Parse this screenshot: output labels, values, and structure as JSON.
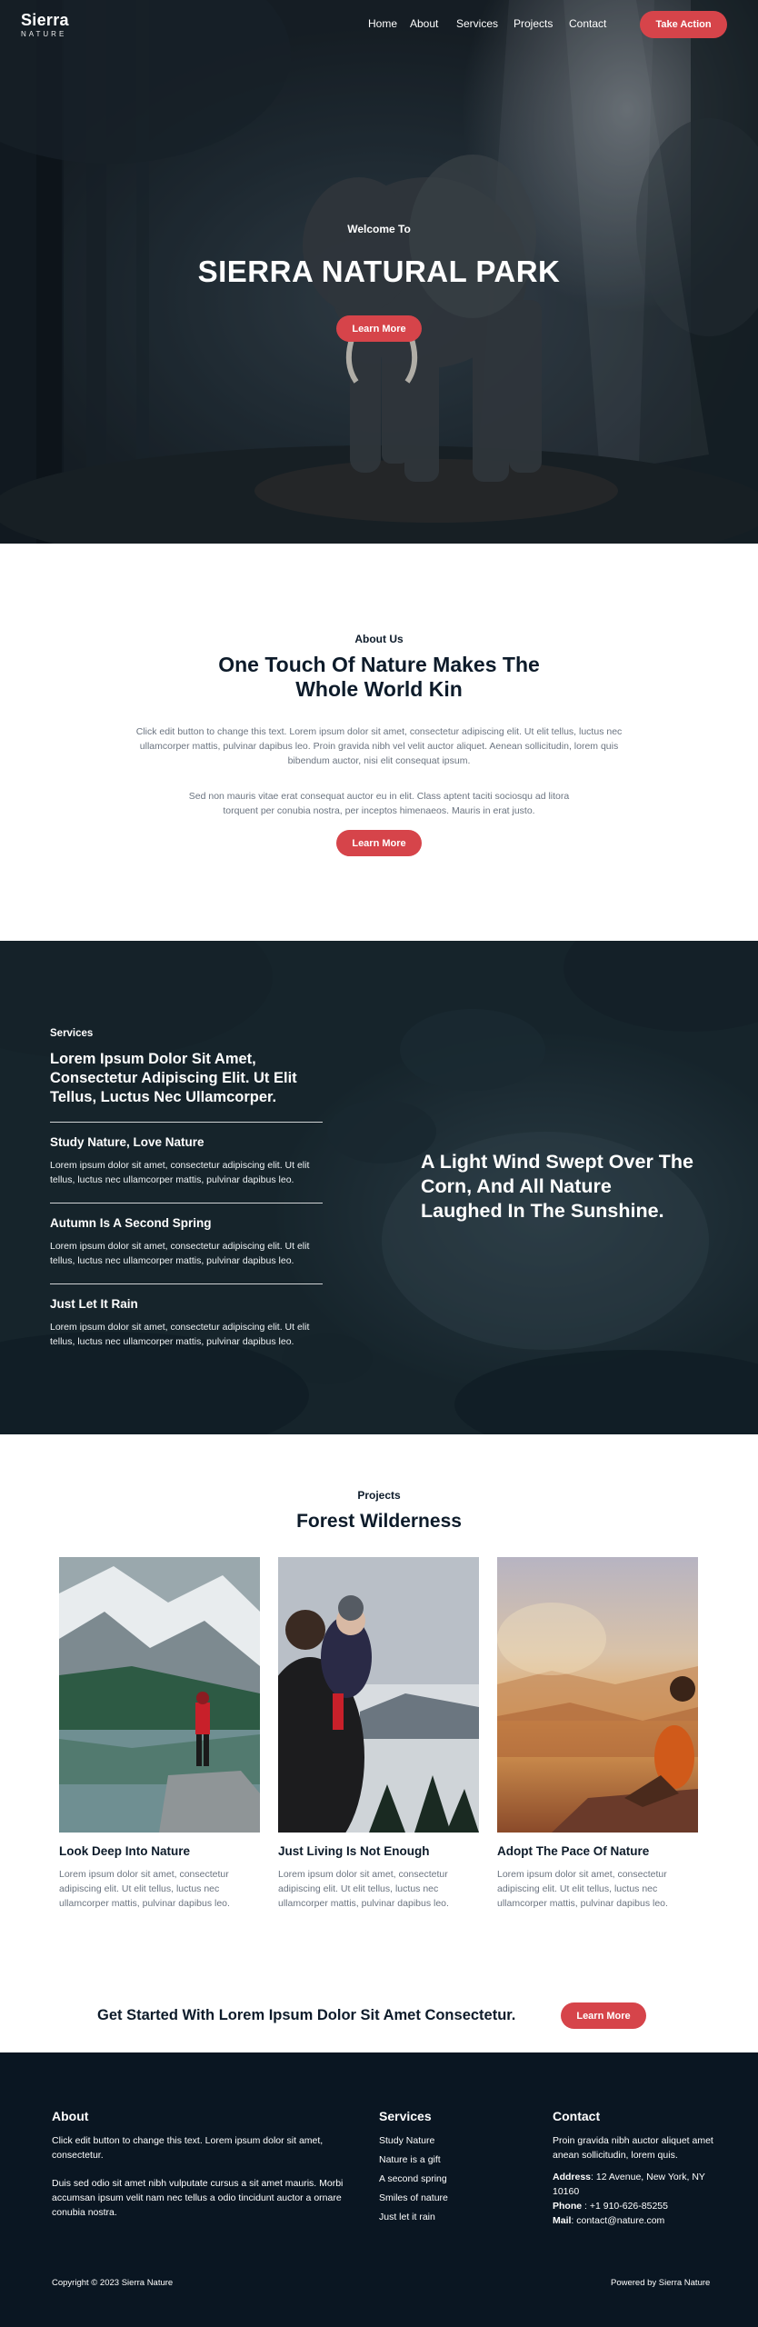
{
  "colors": {
    "accent": "#d6444a",
    "dark": "#0a1622",
    "text": "#0d1b2a",
    "muted": "#6b7480"
  },
  "header": {
    "logo_main": "Sierra",
    "logo_sub": "NATURE",
    "nav": [
      "Home",
      "About",
      "Services",
      "Projects",
      "Contact"
    ],
    "cta_label": "Take Action"
  },
  "hero": {
    "welcome": "Welcome To",
    "title": "SIERRA NATURAL PARK",
    "button": "Learn More"
  },
  "about": {
    "label": "About Us",
    "title": "One Touch Of Nature Makes The Whole World Kin",
    "paragraph1": "Click edit button to change this text. Lorem ipsum dolor sit amet, consectetur adipiscing elit. Ut elit tellus, luctus nec ullamcorper mattis, pulvinar dapibus leo. Proin gravida nibh vel velit auctor aliquet. Aenean sollicitudin, lorem quis bibendum auctor, nisi elit consequat ipsum.",
    "paragraph2": "Sed non mauris vitae erat consequat auctor eu in elit. Class aptent taciti sociosqu ad litora torquent per conubia nostra, per inceptos himenaeos. Mauris in erat justo.",
    "button": "Learn More"
  },
  "services": {
    "label": "Services",
    "heading": "Lorem Ipsum Dolor Sit Amet, Consectetur Adipiscing Elit. Ut Elit Tellus, Luctus Nec Ullamcorper.",
    "items": [
      {
        "title": "Study Nature, Love Nature",
        "text": "Lorem ipsum dolor sit amet, consectetur adipiscing elit. Ut elit tellus, luctus nec ullamcorper mattis, pulvinar dapibus leo."
      },
      {
        "title": "Autumn Is A Second Spring",
        "text": "Lorem ipsum dolor sit amet, consectetur adipiscing elit. Ut elit tellus, luctus nec ullamcorper mattis, pulvinar dapibus leo."
      },
      {
        "title": "Just Let It Rain",
        "text": "Lorem ipsum dolor sit amet, consectetur adipiscing elit. Ut elit tellus, luctus nec ullamcorper mattis, pulvinar dapibus leo."
      }
    ],
    "quote": "A Light Wind Swept Over The Corn, And All Nature Laughed In The Sunshine."
  },
  "projects": {
    "label": "Projects",
    "title": "Forest Wilderness",
    "cards": [
      {
        "title": "Look Deep Into Nature",
        "text": "Lorem ipsum dolor sit amet, consectetur adipiscing elit. Ut elit tellus, luctus nec ullamcorper mattis, pulvinar dapibus leo."
      },
      {
        "title": "Just Living Is Not Enough",
        "text": "Lorem ipsum dolor sit amet, consectetur adipiscing elit. Ut elit tellus, luctus nec ullamcorper mattis, pulvinar dapibus leo."
      },
      {
        "title": "Adopt The Pace Of Nature",
        "text": "Lorem ipsum dolor sit amet, consectetur adipiscing elit. Ut elit tellus, luctus nec ullamcorper mattis, pulvinar dapibus leo."
      }
    ]
  },
  "cta": {
    "text": "Get Started With Lorem Ipsum Dolor Sit Amet Consectetur.",
    "button": "Learn More"
  },
  "footer": {
    "about_heading": "About",
    "about_p1": "Click edit button to change this text. Lorem ipsum dolor sit amet, consectetur.",
    "about_p2": "Duis sed odio sit amet nibh vulputate cursus a sit amet mauris. Morbi accumsan ipsum velit nam nec tellus a odio tincidunt auctor a ornare conubia nostra.",
    "services_heading": "Services",
    "links": [
      "Study Nature",
      "Nature is a gift",
      "A second spring",
      "Smiles of nature",
      "Just let it rain"
    ],
    "contact_heading": "Contact",
    "contact_text": "Proin gravida nibh auctor aliquet amet anean sollicitudin, lorem quis.",
    "address_label": "Address",
    "address_value": ": 12 Avenue, New York, NY 10160",
    "phone_label": "Phone",
    "phone_value": " : +1 910-626-85255",
    "mail_label": "Mail",
    "mail_value": ": contact@nature.com",
    "copyright": "Copyright © 2023 Sierra Nature",
    "powered": "Powered by Sierra Nature"
  }
}
